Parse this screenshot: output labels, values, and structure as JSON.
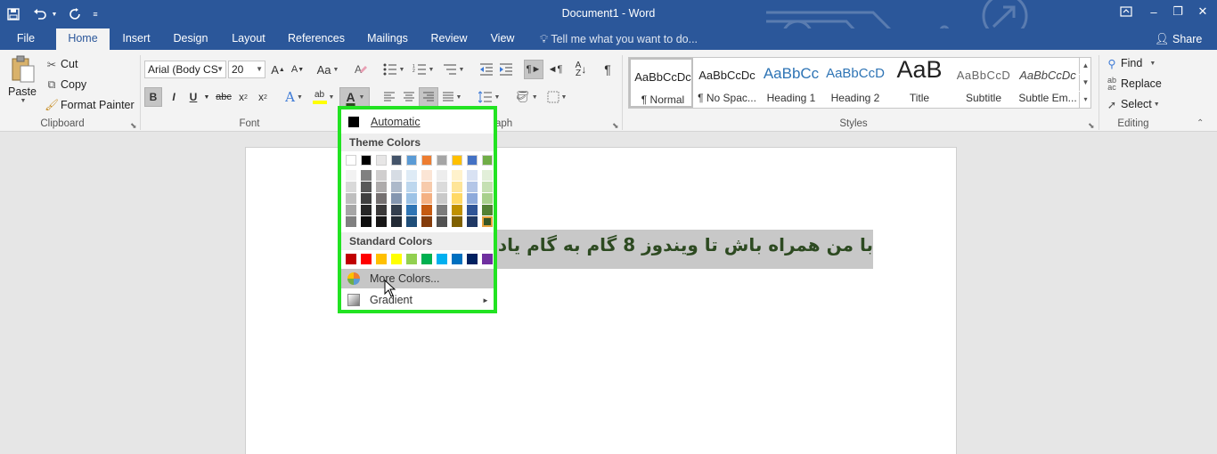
{
  "window": {
    "title": "Document1 - Word",
    "ribbon_display_icon": "ribbon-display-options-icon",
    "minimize": "–",
    "restore": "❐",
    "close": "✕"
  },
  "quick_access": {
    "save": "save-icon",
    "undo": "undo-icon",
    "redo": "redo-icon",
    "customize": "customize-icon"
  },
  "tabs": [
    {
      "label": "File"
    },
    {
      "label": "Home"
    },
    {
      "label": "Insert"
    },
    {
      "label": "Design"
    },
    {
      "label": "Layout"
    },
    {
      "label": "References"
    },
    {
      "label": "Mailings"
    },
    {
      "label": "Review"
    },
    {
      "label": "View"
    }
  ],
  "tellme": {
    "text": "Tell me what you want to do..."
  },
  "share": {
    "label": "Share"
  },
  "clipboard": {
    "paste": "Paste",
    "cut": "Cut",
    "copy": "Copy",
    "format_painter": "Format Painter",
    "group_label": "Clipboard"
  },
  "font": {
    "font_name": "Arial (Body CS",
    "font_size": "20",
    "grow": "A",
    "shrink": "A",
    "case": "Aa",
    "bold": "B",
    "italic": "I",
    "underline": "U",
    "strike": "abc",
    "subscript": "x",
    "superscript": "x",
    "sub_mark": "2",
    "sup_mark": "2",
    "text_effects": "A",
    "highlight": "ab",
    "font_color": "A",
    "group_label": "Font"
  },
  "paragraph": {
    "group_label": "Paragraph",
    "group_label_visible": "aph"
  },
  "styles": {
    "items": [
      {
        "preview": "AaBbCcDc",
        "name": "¶ Normal"
      },
      {
        "preview": "AaBbCcDc",
        "name": "¶ No Spac..."
      },
      {
        "preview": "AaBbCc",
        "name": "Heading 1"
      },
      {
        "preview": "AaBbCcD",
        "name": "Heading 2"
      },
      {
        "preview": "AaB",
        "name": "Title"
      },
      {
        "preview": "AaBbCcD",
        "name": "Subtitle"
      },
      {
        "preview": "AaBbCcDc",
        "name": "Subtle Em..."
      }
    ],
    "group_label": "Styles"
  },
  "editing": {
    "find": "Find",
    "replace": "Replace",
    "select": "Select",
    "group_label": "Editing"
  },
  "document": {
    "text": "با من همراه باش تا ویندوز 8 گام به گام یاد بگیری"
  },
  "color_menu": {
    "automatic": "Automatic",
    "theme_header": "Theme Colors",
    "standard_header": "Standard Colors",
    "more_colors": "More Colors...",
    "gradient": "Gradient",
    "submenu_arrow": "►",
    "theme_top": [
      "#ffffff",
      "#000000",
      "#e7e6e6",
      "#44546a",
      "#5b9bd5",
      "#ed7d31",
      "#a5a5a5",
      "#ffc000",
      "#4472c4",
      "#70ad47"
    ],
    "theme_shades": [
      [
        "#f2f2f2",
        "#d9d9d9",
        "#bfbfbf",
        "#a6a6a6",
        "#808080"
      ],
      [
        "#808080",
        "#595959",
        "#404040",
        "#262626",
        "#0d0d0d"
      ],
      [
        "#d0cece",
        "#aeabab",
        "#757070",
        "#3a3838",
        "#171616"
      ],
      [
        "#d6dce4",
        "#adb9ca",
        "#8496b0",
        "#333f4f",
        "#222a35"
      ],
      [
        "#deebf6",
        "#bdd7ee",
        "#9dc3e6",
        "#2e75b5",
        "#1f4e79"
      ],
      [
        "#fbe5d5",
        "#f7cbac",
        "#f4b183",
        "#c55a11",
        "#843c0b"
      ],
      [
        "#ededed",
        "#dbdbdb",
        "#c9c9c9",
        "#7b7b7b",
        "#525252"
      ],
      [
        "#fff2cc",
        "#fee599",
        "#ffd966",
        "#bf9000",
        "#7f6000"
      ],
      [
        "#d9e2f3",
        "#b4c6e7",
        "#8eaadb",
        "#2f5496",
        "#1f3864"
      ],
      [
        "#e2efd9",
        "#c5e0b3",
        "#a8d08d",
        "#538135",
        "#375623"
      ]
    ],
    "standard": [
      "#c00000",
      "#ff0000",
      "#ffc000",
      "#ffff00",
      "#92d050",
      "#00b050",
      "#00b0f0",
      "#0070c0",
      "#002060",
      "#7030a0"
    ]
  },
  "colors": {
    "accent": "#2b579a",
    "highlight_border": "#22e322",
    "doc_text": "#2d4a21"
  }
}
